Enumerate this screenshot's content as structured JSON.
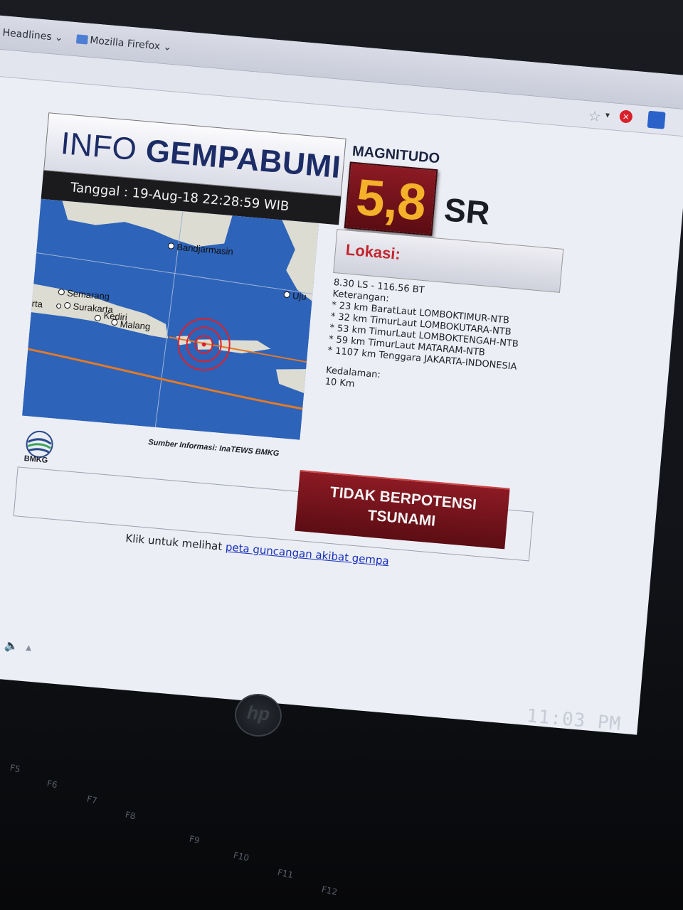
{
  "browser": {
    "bookmarks": [
      {
        "label": "est Headlines"
      },
      {
        "label": "Mozilla Firefox"
      }
    ]
  },
  "card": {
    "title_light": "INFO ",
    "title_bold": "GEMPABUMI",
    "date_text": "Tanggal : 19-Aug-18 22:28:59 WIB",
    "magnitude_label": "MAGNITUDO",
    "magnitude_value": "5,8",
    "magnitude_unit": "SR",
    "lokasi_label": "Lokasi:",
    "coords": "8.30 LS - 116.56 BT",
    "keterangan_label": "Keterangan:",
    "keterangan_items": [
      "* 23 km BaratLaut LOMBOKTIMUR-NTB",
      "* 32 km TimurLaut LOMBOKUTARA-NTB",
      "* 53 km TimurLaut LOMBOKTENGAH-NTB",
      "* 59 km TimurLaut MATARAM-NTB",
      "* 1107 km Tenggara JAKARTA-INDONESIA"
    ],
    "kedalaman_label": "Kedalaman:",
    "kedalaman_value": "10 Km",
    "source": "Sumber Informasi: InaTEWS BMKG",
    "logo_text": "BMKG",
    "tsunami_line1": "TIDAK BERPOTENSI",
    "tsunami_line2": "TSUNAMI",
    "footer_text": "Klik untuk melihat ",
    "footer_link": "peta guncangan akibat gempa"
  },
  "map": {
    "cities": {
      "banjarmasin": "Bandjarmasin",
      "semarang": "Semarang",
      "surakarta": "Surakarta",
      "kediri": "Kediri",
      "malang": "Malang",
      "uju": "Uju",
      "jakarta_partial": "rta"
    },
    "sea_color": "#2d63b8",
    "land_color": "#dcdcd2",
    "epicenter_color": "#e0202a",
    "fault_color": "#e07a2a"
  },
  "system": {
    "clock": "11:03 PM",
    "brand": "hp",
    "function_keys": [
      "F5",
      "F6",
      "F7",
      "F8",
      "F9",
      "F10",
      "F11",
      "F12"
    ]
  }
}
